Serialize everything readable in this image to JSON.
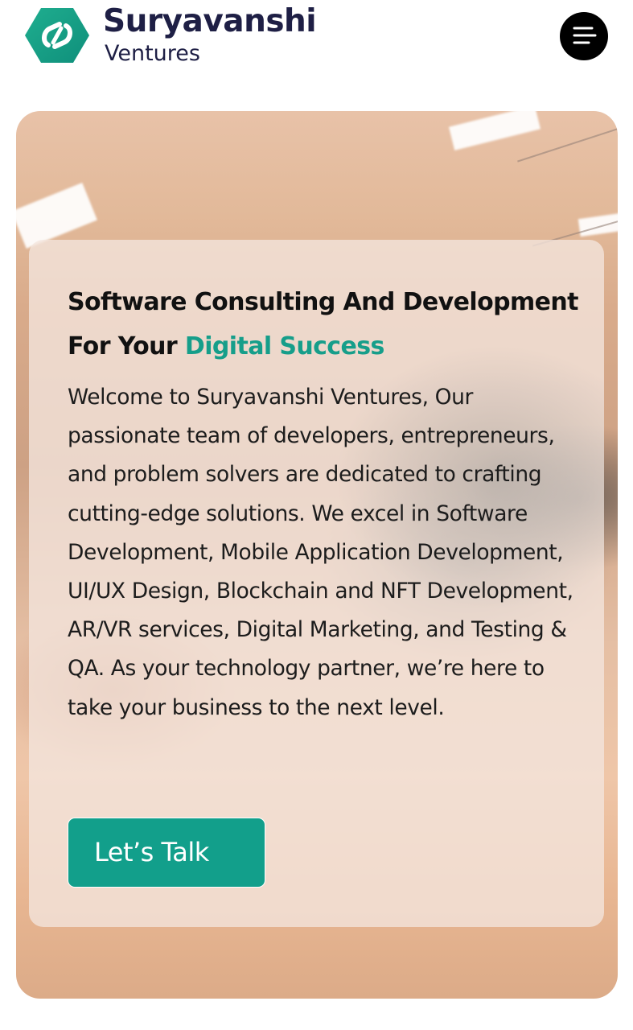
{
  "header": {
    "brand_name": "Suryavanshi",
    "brand_sub": "Ventures",
    "menu_icon": "hamburger-menu-icon",
    "logo_icon": "suryavanshi-hexagon-logo"
  },
  "hero": {
    "title_main": "Software Consulting And Development For Your ",
    "title_accent": "Digital Success",
    "description": "Welcome to Suryavanshi Ventures, Our passionate team of developers, entrepreneurs, and problem solvers are dedicated to crafting cutting-edge solutions. We excel in Software Development, Mobile Application Development, UI/UX Design, Blockchain and NFT Development, AR/VR services, Digital Marketing, and Testing & QA. As your technology partner, we’re here to take your business to the next level.",
    "cta_label": "Let’s Talk"
  },
  "colors": {
    "accent": "#169e8a",
    "brand_text": "#1e1f45",
    "button_bg": "#129f8b"
  }
}
